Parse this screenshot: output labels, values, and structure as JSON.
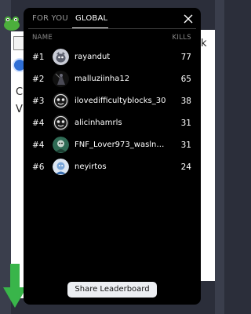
{
  "tabs": {
    "for_you": "FOR YOU",
    "global": "GLOBAL"
  },
  "columns": {
    "name": "NAME",
    "kills": "KILLS"
  },
  "rows": [
    {
      "rank": "#1",
      "name": "rayandut",
      "kills": "77"
    },
    {
      "rank": "#2",
      "name": "malluziinha12",
      "kills": "65"
    },
    {
      "rank": "#3",
      "name": "ilovedifficultyblocks_30",
      "kills": "38"
    },
    {
      "rank": "#4",
      "name": "alicinhamrls",
      "kills": "31"
    },
    {
      "rank": "#4",
      "name": "FNF_Lover973_waslnac…",
      "kills": "31"
    },
    {
      "rank": "#6",
      "name": "neyirtos",
      "kills": "24"
    }
  ],
  "share_button": "Share Leaderboard",
  "background_text": {
    "left_1": "C",
    "left_2": "V",
    "right_1": "k"
  },
  "icons": {
    "close": "close-icon",
    "avatars": [
      "avatar-creature-icon",
      "avatar-dark-figure-icon",
      "avatar-emblem-icon",
      "avatar-emblem-icon",
      "avatar-green-character-icon",
      "avatar-blue-character-icon"
    ]
  },
  "colors": {
    "panel_background": "#000000",
    "text_primary": "#ffffff",
    "text_muted": "#8a8a8a",
    "button_background": "#eceef2"
  }
}
